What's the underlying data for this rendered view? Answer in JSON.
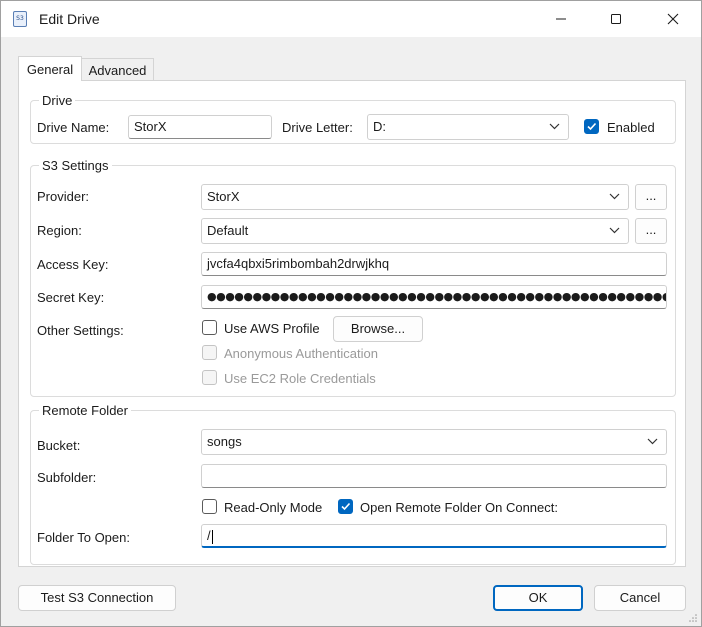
{
  "window": {
    "title": "Edit Drive",
    "icon_text": "S3",
    "icon": "app-drive-icon"
  },
  "tabs": [
    {
      "label": "General",
      "selected": true
    },
    {
      "label": "Advanced",
      "selected": false
    }
  ],
  "drive": {
    "group_title": "Drive",
    "name_label": "Drive Name:",
    "name_value": "StorX",
    "letter_label": "Drive Letter:",
    "letter_value": "D:",
    "enabled_label": "Enabled",
    "enabled_checked": true
  },
  "s3": {
    "group_title": "S3 Settings",
    "provider_label": "Provider:",
    "provider_value": "StorX",
    "region_label": "Region:",
    "region_value": "Default",
    "browse_ellipsis": "...",
    "access_key_label": "Access Key:",
    "access_key_value": "jvcfa4qbxi5rimbombah2drwjkhq",
    "secret_key_label": "Secret Key:",
    "secret_key_value": "●●●●●●●●●●●●●●●●●●●●●●●●●●●●●●●●●●●●●●●●●●●●●●●●●●●●●●●●●●●●●●●",
    "other_settings_label": "Other Settings:",
    "use_aws_profile_label": "Use AWS Profile",
    "browse_label": "Browse...",
    "anonymous_auth_label": "Anonymous Authentication",
    "ec2_role_label": "Use EC2 Role Credentials"
  },
  "remote": {
    "group_title": "Remote Folder",
    "bucket_label": "Bucket:",
    "bucket_value": "songs",
    "subfolder_label": "Subfolder:",
    "subfolder_value": "",
    "read_only_label": "Read-Only Mode",
    "read_only_checked": false,
    "open_on_connect_label": "Open Remote Folder On Connect:",
    "open_on_connect_checked": true,
    "folder_to_open_label": "Folder To Open:",
    "folder_to_open_value": "/"
  },
  "footer": {
    "test_label": "Test S3 Connection",
    "ok_label": "OK",
    "cancel_label": "Cancel"
  },
  "colors": {
    "accent": "#0067c0",
    "window_bg": "#f0f0f0",
    "panel_bg": "#ffffff"
  }
}
